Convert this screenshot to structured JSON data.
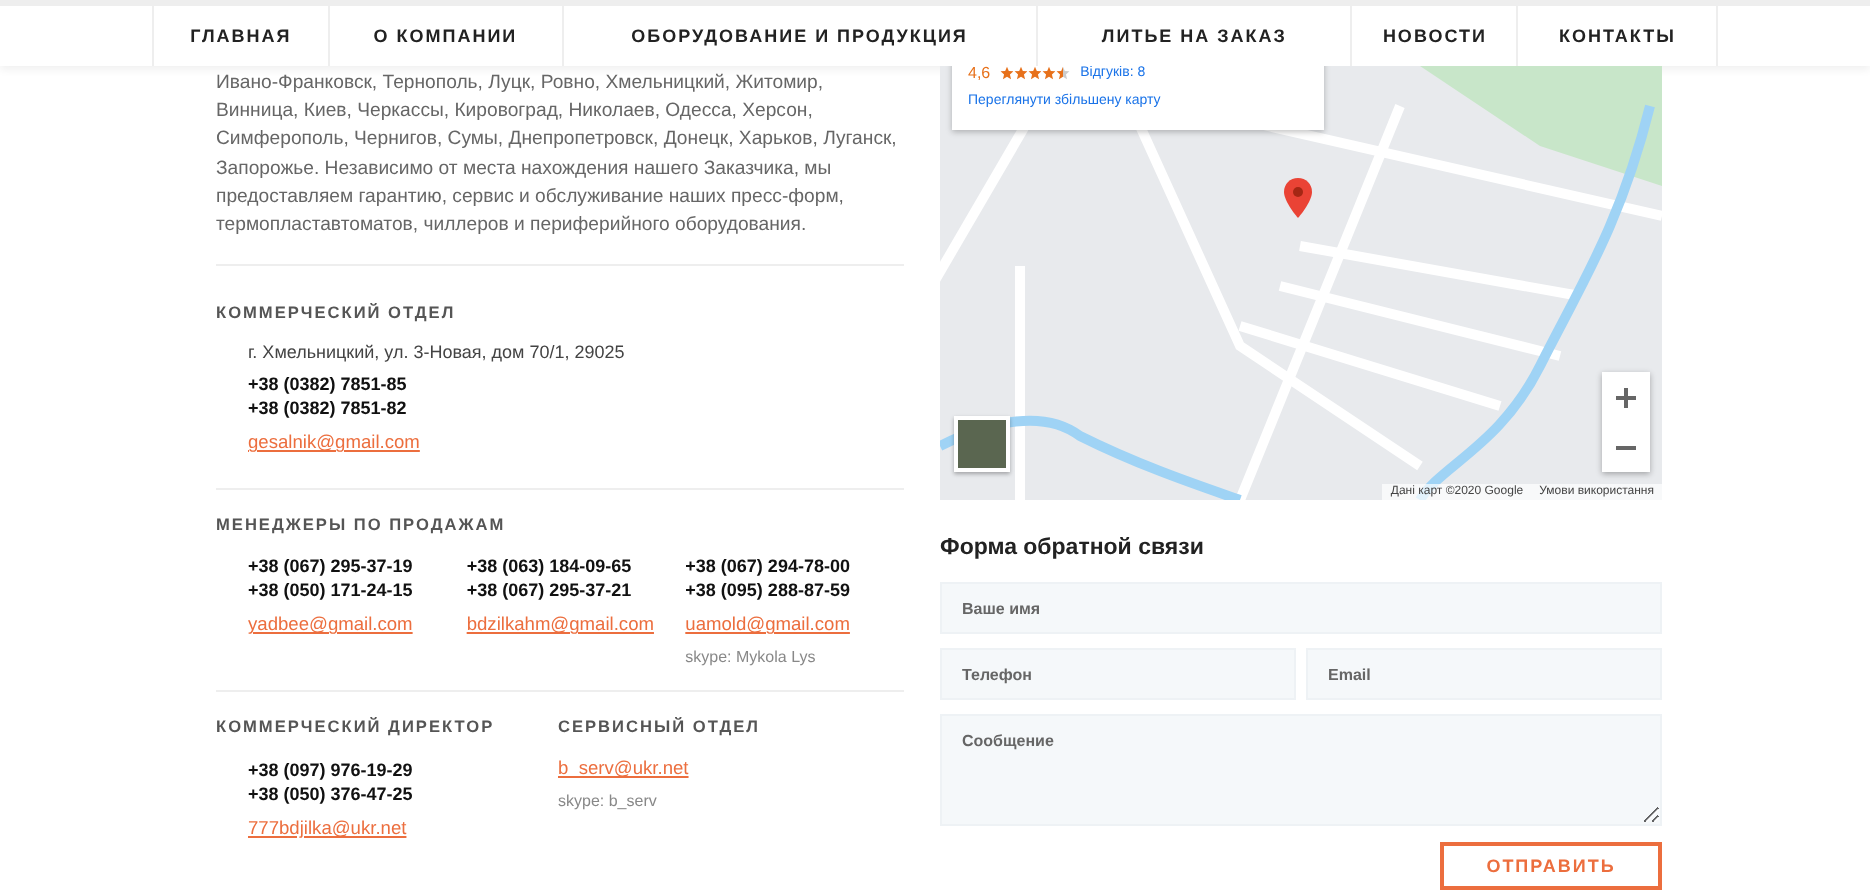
{
  "nav": [
    {
      "label": "ГЛАВНАЯ"
    },
    {
      "label": "О КОМПАНИИ"
    },
    {
      "label": "ОБОРУДОВАНИЕ И ПРОДУКЦИЯ"
    },
    {
      "label": "ЛИТЬЕ НА ЗАКАЗ"
    },
    {
      "label": "НОВОСТИ"
    },
    {
      "label": "КОНТАКТЫ"
    }
  ],
  "intro": "Ивано-Франковск, Тернополь, Луцк, Ровно, Хмельницкий, Житомир, Винница, Киев, Черкассы, Кировоград, Николаев, Одесса, Херсон, Симферополь, Чернигов, Сумы, Днепропетровск, Донецк, Харьков, Луганск, Запорожье. Независимо от места нахождения нашего Заказчика, мы предоставляем гарантию, сервис и обслуживание наших пресс-форм, термопластавтоматов, чиллеров и периферийного оборудования.",
  "commercial": {
    "heading": "КОММЕРЧЕСКИЙ ОТДЕЛ",
    "address": "г. Хмельницкий, ул. 3-Новая, дом 70/1, 29025",
    "phones": [
      "+38 (0382) 7851-85",
      "+38 (0382) 7851-82"
    ],
    "email": "gesalnik@gmail.com"
  },
  "managers": {
    "heading": "МЕНЕДЖЕРЫ ПО ПРОДАЖАМ",
    "contacts": [
      {
        "phones": [
          "+38 (067) 295-37-19",
          "+38 (050) 171-24-15"
        ],
        "email": "yadbee@gmail.com"
      },
      {
        "phones": [
          "+38 (063) 184-09-65",
          "+38 (067) 295-37-21"
        ],
        "email": "bdzilkahm@gmail.com"
      },
      {
        "phones": [
          "+38 (067) 294-78-00",
          "+38 (095) 288-87-59"
        ],
        "email": "uamold@gmail.com",
        "skype": "skype: Mykola Lys"
      }
    ]
  },
  "director": {
    "heading": "КОММЕРЧЕСКИЙ ДИРЕКТОР",
    "phones": [
      "+38 (097) 976-19-29",
      "+38 (050) 376-47-25"
    ],
    "email": "777bdjilka@ukr.net"
  },
  "service": {
    "heading": "СЕРВИСНЫЙ ОТДЕЛ",
    "email": "b_serv@ukr.net",
    "skype": "skype: b_serv"
  },
  "map": {
    "rating": "4,6",
    "stars": 4.5,
    "reviews": "Відгуків: 8",
    "larger_map": "Переглянути збільшену карту",
    "attribution": "Дані карт ©2020 Google",
    "terms": "Умови використання"
  },
  "form": {
    "title": "Форма обратной связи",
    "fields": [
      {
        "placeholder": "Ваше имя",
        "kind": "wide"
      },
      {
        "placeholder": "Телефон",
        "kind": "half"
      },
      {
        "placeholder": "Email",
        "kind": "half"
      },
      {
        "placeholder": "Сообщение",
        "kind": "area"
      }
    ],
    "submit": "ОТПРАВИТЬ"
  }
}
